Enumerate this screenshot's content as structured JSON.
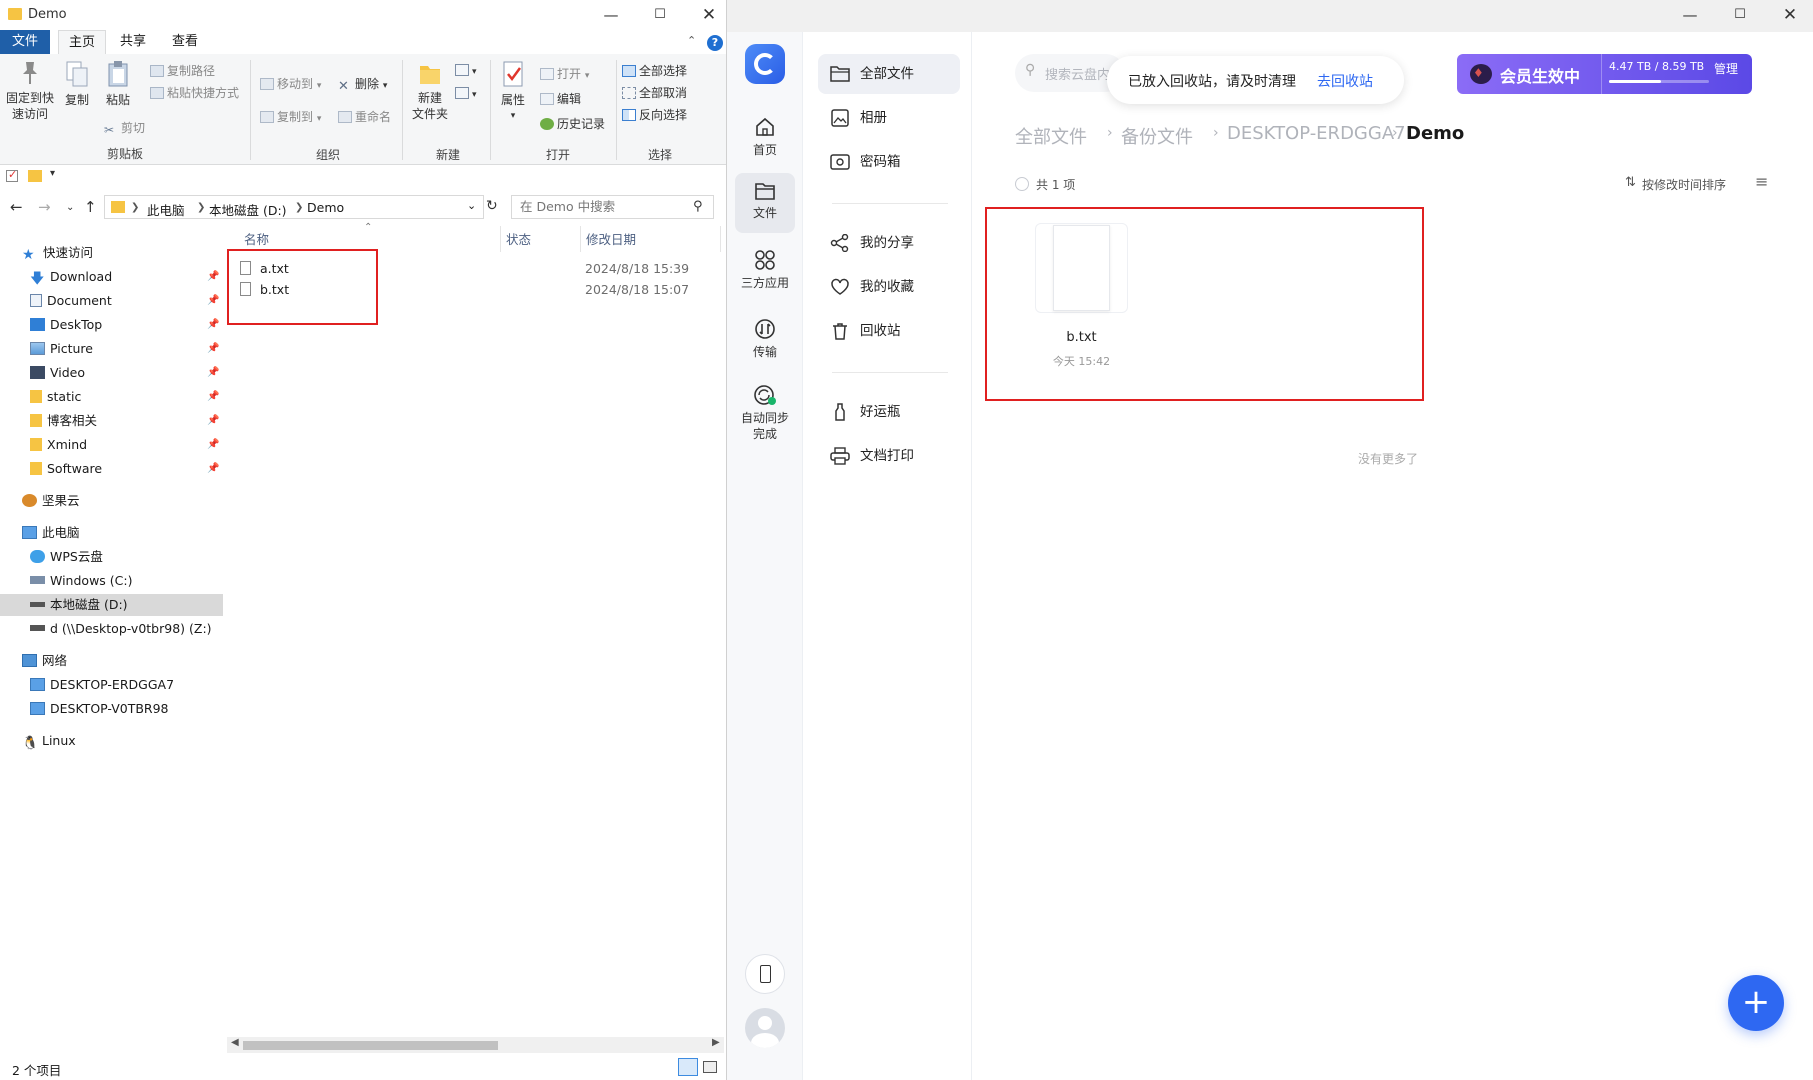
{
  "explorer": {
    "window_title": "Demo",
    "ribbon_tabs": [
      "文件",
      "主页",
      "共享",
      "查看"
    ],
    "clipboard": {
      "pin_label_1": "固定到快",
      "pin_label_2": "速访问",
      "copy": "复制",
      "paste": "粘贴",
      "copy_path": "复制路径",
      "paste_shortcut": "粘贴快捷方式",
      "cut": "剪切",
      "group": "剪贴板"
    },
    "organize": {
      "move_to": "移动到",
      "copy_to": "复制到",
      "delete": "删除",
      "rename": "重命名",
      "group": "组织"
    },
    "new": {
      "new_folder_1": "新建",
      "new_folder_2": "文件夹",
      "group": "新建"
    },
    "open": {
      "properties": "属性",
      "open": "打开",
      "edit": "编辑",
      "history": "历史记录",
      "group": "打开"
    },
    "select": {
      "select_all": "全部选择",
      "select_none": "全部取消",
      "invert": "反向选择",
      "group": "选择"
    },
    "address": [
      "此电脑",
      "本地磁盘 (D:)",
      "Demo"
    ],
    "search_placeholder": "在 Demo 中搜索",
    "nav": {
      "quick_access": "快速访问",
      "quick_items": [
        "Download",
        "Document",
        "DeskTop",
        "Picture",
        "Video",
        "static",
        "博客相关",
        "Xmind",
        "Software"
      ],
      "jianguoyun": "坚果云",
      "this_pc": "此电脑",
      "pc_items": [
        "WPS云盘",
        "Windows (C:)",
        "本地磁盘 (D:)",
        "d (\\\\Desktop-v0tbr98) (Z:)"
      ],
      "network": "网络",
      "network_items": [
        "DESKTOP-ERDGGA7",
        "DESKTOP-V0TBR98"
      ],
      "linux": "Linux"
    },
    "columns": {
      "name": "名称",
      "status": "状态",
      "modified": "修改日期"
    },
    "files": [
      {
        "name": "a.txt",
        "modified": "2024/8/18 15:39"
      },
      {
        "name": "b.txt",
        "modified": "2024/8/18 15:07"
      }
    ],
    "status": "2 个项目"
  },
  "netdisk": {
    "rail": {
      "home": "首页",
      "files": "文件",
      "apps": "三方应用",
      "transfer": "传输",
      "autosync_1": "自动同步",
      "autosync_2": "完成"
    },
    "nav": {
      "all_files": "全部文件",
      "albums": "相册",
      "safe_box": "密码箱",
      "my_share": "我的分享",
      "favorites": "我的收藏",
      "recycle": "回收站",
      "lucky_bottle": "好运瓶",
      "doc_print": "文档打印"
    },
    "search_placeholder": "搜索云盘内文件",
    "toast": {
      "message": "已放入回收站，请及时清理",
      "action": "去回收站"
    },
    "vip": {
      "label": "会员生效中",
      "storage": "4.47 TB / 8.59 TB",
      "manage": "管理",
      "usage_fraction": 0.52
    },
    "breadcrumb": [
      "全部文件",
      "备份文件",
      "DESKTOP-ERDGGA7",
      "Demo"
    ],
    "count": "共 1 项",
    "sort": "按修改时间排序",
    "file": {
      "name": "b.txt",
      "time": "今天 15:42"
    },
    "no_more": "没有更多了"
  }
}
